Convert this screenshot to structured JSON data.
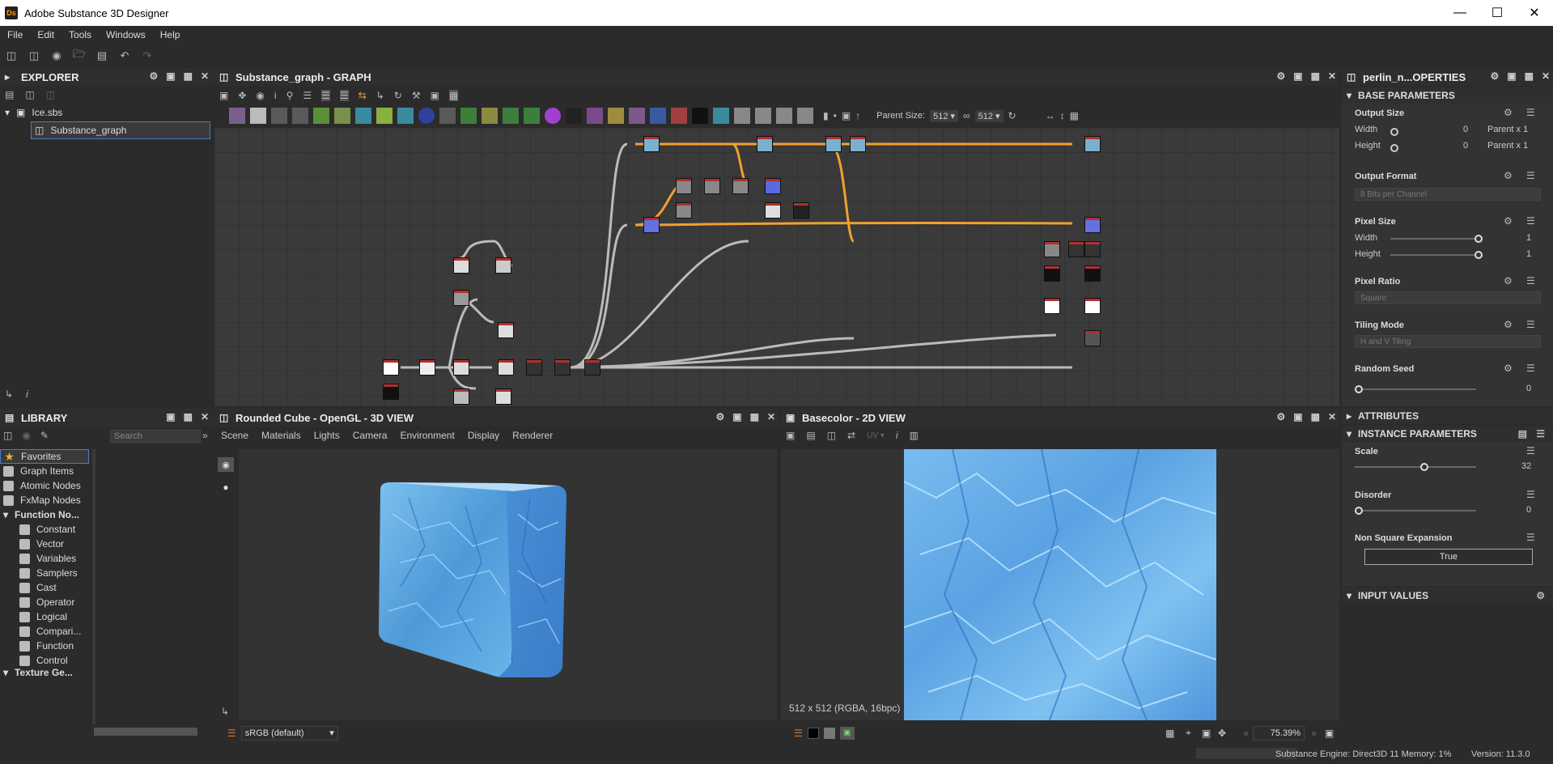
{
  "app": {
    "title": "Adobe Substance 3D Designer",
    "logo": "Ds"
  },
  "menu": [
    "File",
    "Edit",
    "Tools",
    "Windows",
    "Help"
  ],
  "explorer": {
    "title": "EXPLORER",
    "package": "Ice.sbs",
    "graph": "Substance_graph"
  },
  "graph_panel": {
    "title": "Substance_graph - GRAPH",
    "parent_size_label": "Parent Size:",
    "size_w": "512",
    "size_h": "512"
  },
  "library": {
    "title": "LIBRARY",
    "search_placeholder": "Search",
    "categories": [
      "Favorites",
      "Graph Items",
      "Atomic Nodes",
      "FxMap Nodes",
      "Function No..."
    ],
    "function_items": [
      "Constant",
      "Vector",
      "Variables",
      "Samplers",
      "Cast",
      "Operator",
      "Logical",
      "Compari...",
      "Function",
      "Control"
    ],
    "cut_item": "Texture Ge..."
  },
  "view3d": {
    "title": "Rounded Cube - OpenGL - 3D VIEW",
    "menu": [
      "Scene",
      "Materials",
      "Lights",
      "Camera",
      "Environment",
      "Display",
      "Renderer"
    ],
    "colorspace": "sRGB (default)"
  },
  "view2d": {
    "title": "Basecolor - 2D VIEW",
    "uv_label": "UV",
    "info": "512 x 512 (RGBA, 16bpc)",
    "zoom": "75.39%"
  },
  "properties": {
    "title": "perlin_n...OPERTIES",
    "base_parameters": "BASE PARAMETERS",
    "output_size": {
      "label": "Output Size",
      "width_label": "Width",
      "width_value": "0",
      "width_rel": "Parent x 1",
      "height_label": "Height",
      "height_value": "0",
      "height_rel": "Parent x 1"
    },
    "output_format": {
      "label": "Output Format",
      "value": "8 Bits per Channel"
    },
    "pixel_size": {
      "label": "Pixel Size",
      "width_label": "Width",
      "width_value": "1",
      "height_label": "Height",
      "height_value": "1"
    },
    "pixel_ratio": {
      "label": "Pixel Ratio",
      "value": "Square"
    },
    "tiling_mode": {
      "label": "Tiling Mode",
      "value": "H and V Tiling"
    },
    "random_seed": {
      "label": "Random Seed",
      "value": "0"
    },
    "attributes": "ATTRIBUTES",
    "instance_parameters": "INSTANCE PARAMETERS",
    "scale": {
      "label": "Scale",
      "value": "32",
      "level": 0.56
    },
    "disorder": {
      "label": "Disorder",
      "value": "0",
      "level": 0
    },
    "non_square": {
      "label": "Non Square Expansion",
      "value": "True"
    },
    "input_values": "INPUT VALUES"
  },
  "status": {
    "engine": "Substance Engine: Direct3D 11  Memory: 1%",
    "version": "Version: 11.3.0"
  },
  "colors": {
    "accent": "#ff9a00",
    "wire_orange": "#f0a030",
    "ice_light": "#8cc8f0",
    "ice_dark": "#3a7fd0"
  }
}
